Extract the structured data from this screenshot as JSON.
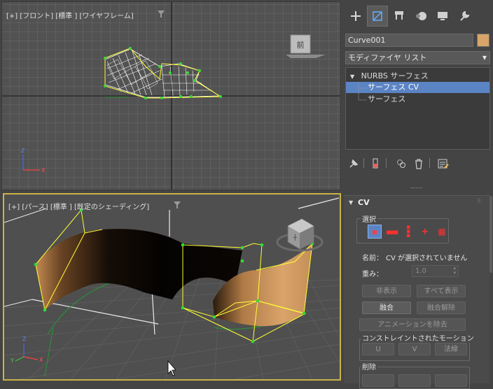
{
  "viewports": {
    "top": {
      "label": "[+] [フロント] [標準 ] [ワイヤフレーム]",
      "viewcube_label": "前"
    },
    "perspective": {
      "label": "[+] [パース] [標準 ] [既定のシェーディング]"
    }
  },
  "panel": {
    "tabs": [
      "create-icon",
      "modify-icon",
      "hierarchy-icon",
      "motion-icon",
      "display-icon",
      "utilities-icon"
    ],
    "object_name": "Curve001",
    "object_color": "#d9a46a",
    "modifier_list": "モディファイヤ リスト",
    "stack": {
      "root": "NURBS サーフェス",
      "items": [
        "サーフェス CV",
        "サーフェス"
      ],
      "selected_index": 0
    },
    "rollout": {
      "title": "CV",
      "selection_group": "選択",
      "name_label": "名前：",
      "name_value": "CV が選択されていません",
      "weight_label": "重み：",
      "weight_value": "1.0",
      "buttons": {
        "hide": "非表示",
        "unhide_all": "すべて表示",
        "fuse": "融合",
        "unfuse": "融合解除",
        "remove_animation": "アニメーションを除去"
      },
      "constrained_group": "コンストレイントされたモーション",
      "constrained": {
        "u": "U",
        "v": "V",
        "normal": "法線"
      },
      "delete_group": "削除"
    }
  }
}
